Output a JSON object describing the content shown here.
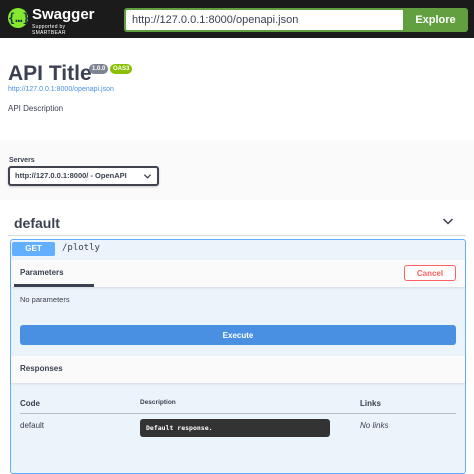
{
  "topbar": {
    "logo_text": "Swagger",
    "logo_sub": "Supported by SMARTBEAR",
    "logo_mark": "{…}",
    "url_value": "http://127.0.0.1:8000/openapi.json",
    "explore_label": "Explore"
  },
  "info": {
    "title": "API Title",
    "version": "1.0.0",
    "oas": "OAS3",
    "spec_link": "http://127.0.0.1:8000/openapi.json",
    "description": "API Description"
  },
  "servers": {
    "label": "Servers",
    "selected": "http://127.0.0.1:8000/ - OpenAPI"
  },
  "tag": {
    "name": "default"
  },
  "operation": {
    "method": "GET",
    "path": "/plotly",
    "parameters_tab": "Parameters",
    "cancel_label": "Cancel",
    "no_params": "No parameters",
    "execute_label": "Execute",
    "responses_title": "Responses",
    "columns": {
      "code": "Code",
      "description": "Description",
      "links": "Links"
    },
    "rows": [
      {
        "code": "default",
        "description": "Default response.",
        "links": "No links"
      }
    ]
  },
  "colors": {
    "topbar_bg": "#1b1b1b",
    "explore_green": "#62a03f",
    "get_blue": "#61affe",
    "execute_blue": "#4990e2",
    "cancel_red": "#ff6060"
  }
}
